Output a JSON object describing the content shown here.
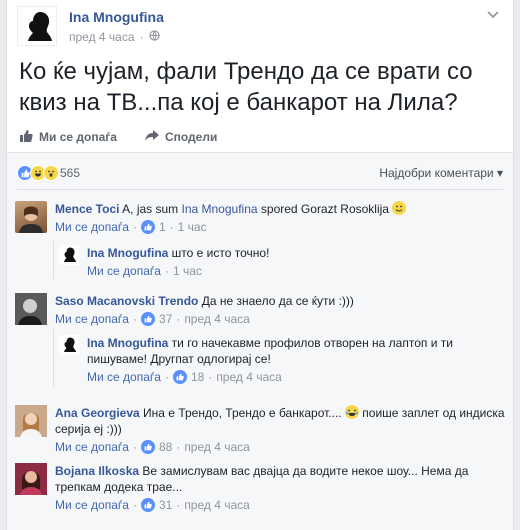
{
  "post": {
    "author": "Ina Mnogufina",
    "time": "пред 4 часа",
    "privacy_icon": "globe-icon",
    "text": "Ко ќе чујам, фали Трендо да се врати со квиз на ТВ...па кој е банкарот на Лила?"
  },
  "actions": {
    "like_label": "Ми се допаѓа",
    "share_label": "Сподели"
  },
  "summary": {
    "reaction_count": "565",
    "sort_label": "Најдобри коментари"
  },
  "colors": {
    "accent": "#365899",
    "like_blue": "#4267b2",
    "love_red": "#f25268",
    "haha_yellow": "#f7d74a"
  },
  "comments": [
    {
      "name": "Mence Toci",
      "text": "A, jas sum",
      "tag": "Ina Mnogufina",
      "text2": "spored Gorazt Rosoklija",
      "like_label": "Ми се допаѓа",
      "likes": "1",
      "time": "1 час"
    },
    {
      "name": "Ina Mnogufina",
      "text": "што е исто точно!",
      "like_label": "Ми се допаѓа",
      "time": "1 час"
    },
    {
      "name": "Saso Macanovski Trendo",
      "text": "Да не знаело да се ќути :)))",
      "like_label": "Ми се допаѓа",
      "likes": "37",
      "time": "пред 4 часа"
    },
    {
      "name": "Ina Mnogufina",
      "text": "ти го начекавме профилов отворен на лаптоп и ти пишуваме! Другпат одлогирај се!",
      "like_label": "Ми се допаѓа",
      "likes": "18",
      "time": "пред 4 часа"
    },
    {
      "name": "Ana Georgieva",
      "text": "Ина е Трендо, Трендо е банкарот....",
      "text2": "поише заплет од индиска серија ej :)))",
      "like_label": "Ми се допаѓа",
      "likes": "88",
      "time": "пред 4 часа"
    },
    {
      "name": "Bojana Ilkoska",
      "text": "Ве замислувам вас двајца да водите некое шоу... Нема да трепкам додека трае...",
      "like_label": "Ми се допаѓа",
      "likes": "31",
      "time": "пред 4 часа"
    }
  ]
}
